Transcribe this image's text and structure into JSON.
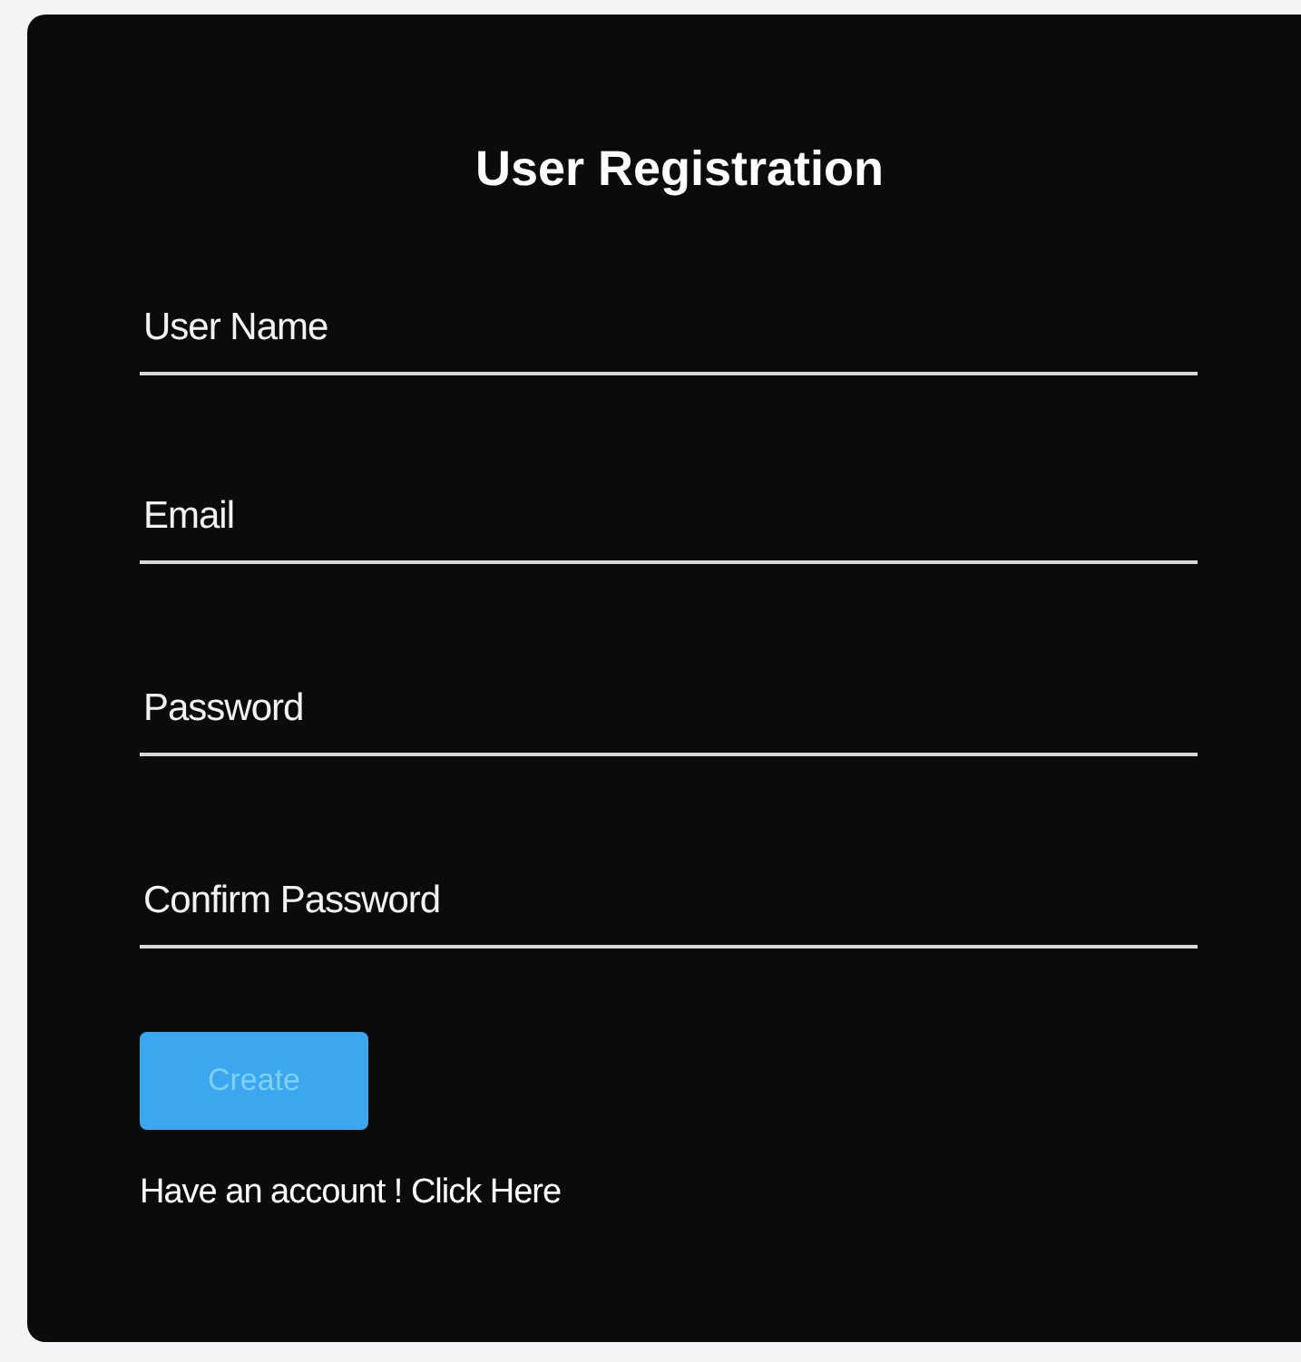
{
  "form": {
    "title": "User Registration",
    "fields": [
      {
        "placeholder": "User Name"
      },
      {
        "placeholder": "Email"
      },
      {
        "placeholder": "Password"
      },
      {
        "placeholder": "Confirm Password"
      }
    ],
    "submit": {
      "label": "Create",
      "disabled": true
    },
    "footer": {
      "text": "Have an account ! ",
      "link": "Click Here"
    }
  }
}
